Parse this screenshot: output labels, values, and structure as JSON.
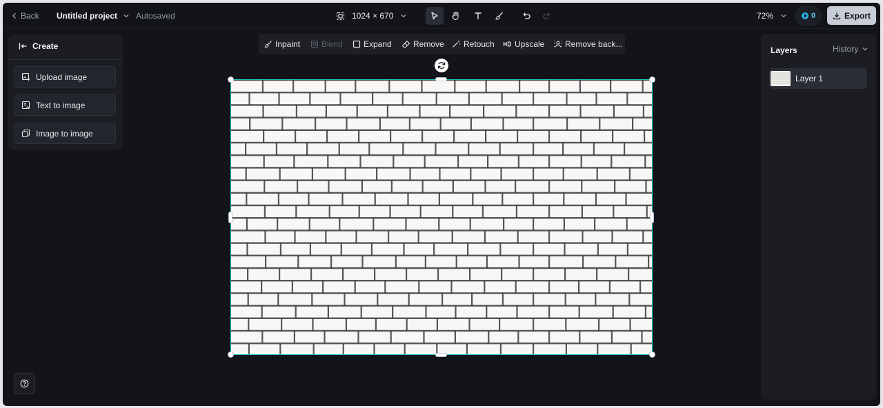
{
  "header": {
    "back_label": "Back",
    "project_title": "Untitled project",
    "autosave_status": "Autosaved",
    "canvas_size": "1024 × 670",
    "tools": [
      "select-icon",
      "hand-icon",
      "text-icon",
      "brush-icon",
      "undo-icon",
      "redo-icon"
    ],
    "zoom": "72%",
    "credits": "0",
    "export_label": "Export"
  },
  "create_panel": {
    "title": "Create",
    "items": [
      {
        "label": "Upload image",
        "icon": "upload-image-icon"
      },
      {
        "label": "Text to image",
        "icon": "text-to-image-icon"
      },
      {
        "label": "Image to image",
        "icon": "image-to-image-icon"
      }
    ]
  },
  "edit_toolbar": {
    "items": [
      {
        "label": "Inpaint",
        "icon": "inpaint-icon",
        "enabled": true
      },
      {
        "label": "Blend",
        "icon": "blend-icon",
        "enabled": false
      },
      {
        "label": "Expand",
        "icon": "expand-icon",
        "enabled": true
      },
      {
        "label": "Remove",
        "icon": "eraser-icon",
        "enabled": true
      },
      {
        "label": "Retouch",
        "icon": "retouch-icon",
        "enabled": true
      },
      {
        "label": "Upscale",
        "icon": "hd-icon",
        "enabled": true
      },
      {
        "label": "Remove back...",
        "icon": "remove-background-icon",
        "enabled": true
      }
    ]
  },
  "canvas": {
    "image": "white-brick-wall",
    "selection_color": "#21c6c6"
  },
  "layers_panel": {
    "title": "Layers",
    "history_label": "History",
    "layers": [
      {
        "name": "Layer 1"
      }
    ]
  },
  "colors": {
    "app_background": "#121419",
    "panel": "#1b1d23",
    "accent": "#21c6c6",
    "credit": "#27b3e8"
  }
}
